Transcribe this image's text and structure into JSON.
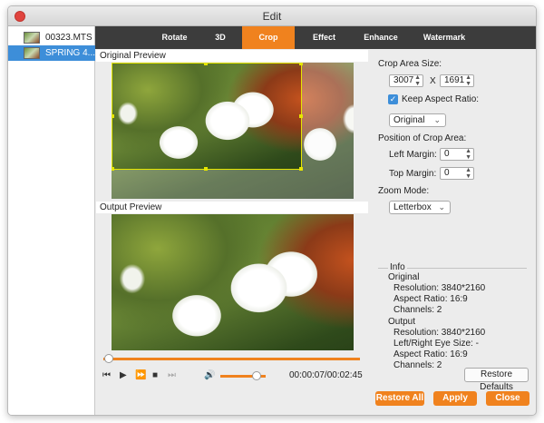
{
  "window": {
    "title": "Edit"
  },
  "files": [
    {
      "name": "00323.MTS",
      "selected": false
    },
    {
      "name": "SPRING 4...",
      "selected": true
    }
  ],
  "tabs": [
    {
      "label": "Rotate",
      "active": false
    },
    {
      "label": "3D",
      "active": false
    },
    {
      "label": "Crop",
      "active": true
    },
    {
      "label": "Effect",
      "active": false
    },
    {
      "label": "Enhance",
      "active": false
    },
    {
      "label": "Watermark",
      "active": false
    }
  ],
  "preview": {
    "original_label": "Original Preview",
    "output_label": "Output Preview"
  },
  "player": {
    "time": "00:00:07/00:02:45",
    "progress": 0.02,
    "volume": 0.8,
    "icons": [
      "skip-back-icon",
      "play-icon",
      "fast-forward-icon",
      "stop-icon",
      "skip-forward-icon",
      "volume-icon"
    ]
  },
  "crop": {
    "area_size_label": "Crop Area Size:",
    "width": "3007",
    "height": "1691",
    "x_label": "X",
    "keep_aspect_label": "Keep Aspect Ratio:",
    "keep_aspect_checked": true,
    "aspect_select": "Original",
    "position_label": "Position of Crop Area:",
    "left_margin_label": "Left Margin:",
    "left_margin": "0",
    "top_margin_label": "Top Margin:",
    "top_margin": "0",
    "zoom_mode_label": "Zoom Mode:",
    "zoom_mode": "Letterbox"
  },
  "info": {
    "title": "Info",
    "original_heading": "Original",
    "original_resolution": "Resolution: 3840*2160",
    "original_aspect": "Aspect Ratio: 16:9",
    "original_channels": "Channels: 2",
    "output_heading": "Output",
    "output_resolution": "Resolution: 3840*2160",
    "output_eye_size": "Left/Right Eye Size: -",
    "output_aspect": "Aspect Ratio: 16:9",
    "output_channels": "Channels: 2"
  },
  "buttons": {
    "restore_defaults": "Restore Defaults",
    "restore_all": "Restore All",
    "apply": "Apply",
    "close": "Close"
  },
  "colors": {
    "accent": "#f0821e",
    "selection": "#3d8ed9",
    "crop_frame": "#e6e600"
  }
}
